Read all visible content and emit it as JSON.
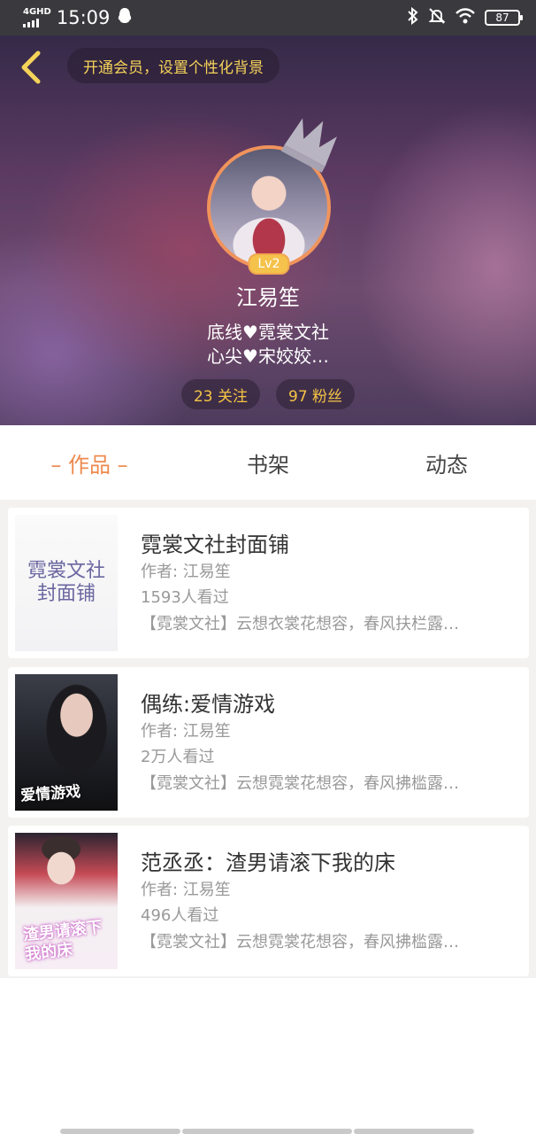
{
  "status_bar": {
    "network": "4GHD",
    "time": "15:09",
    "battery": "87"
  },
  "header": {
    "vip_prompt": "开通会员，设置个性化背景",
    "level": "Lv2",
    "username": "江易笙",
    "bio_line1": "底线♥霓裳文社",
    "bio_line2": "心尖♥宋姣姣…",
    "following": "23 关注",
    "followers": "97 粉丝"
  },
  "tabs": [
    {
      "label": "– 作品 –"
    },
    {
      "label": "书架"
    },
    {
      "label": "动态"
    }
  ],
  "books": [
    {
      "title": "霓裳文社封面铺",
      "author": "作者: 江易笙",
      "views": "1593人看过",
      "desc": "【霓裳文社】云想衣裳花想容，春风扶栏露…",
      "cover_line1": "霓裳文社",
      "cover_line2": "封面铺"
    },
    {
      "title": "偶练:爱情游戏",
      "author": "作者: 江易笙",
      "views": "2万人看过",
      "desc": "【霓裳文社】云想霓裳花想容，春风拂槛露…",
      "cover_text": "爱情游戏"
    },
    {
      "title": "范丞丞：渣男请滚下我的床",
      "author": "作者: 江易笙",
      "views": "496人看过",
      "desc": "【霓裳文社】云想霓裳花想容，春风拂槛露…",
      "cover_text": "渣男请滚下我的床"
    }
  ],
  "colors": {
    "accent": "#ee8a4e",
    "gold": "#f5c445",
    "vip_text": "#f5d35a"
  }
}
